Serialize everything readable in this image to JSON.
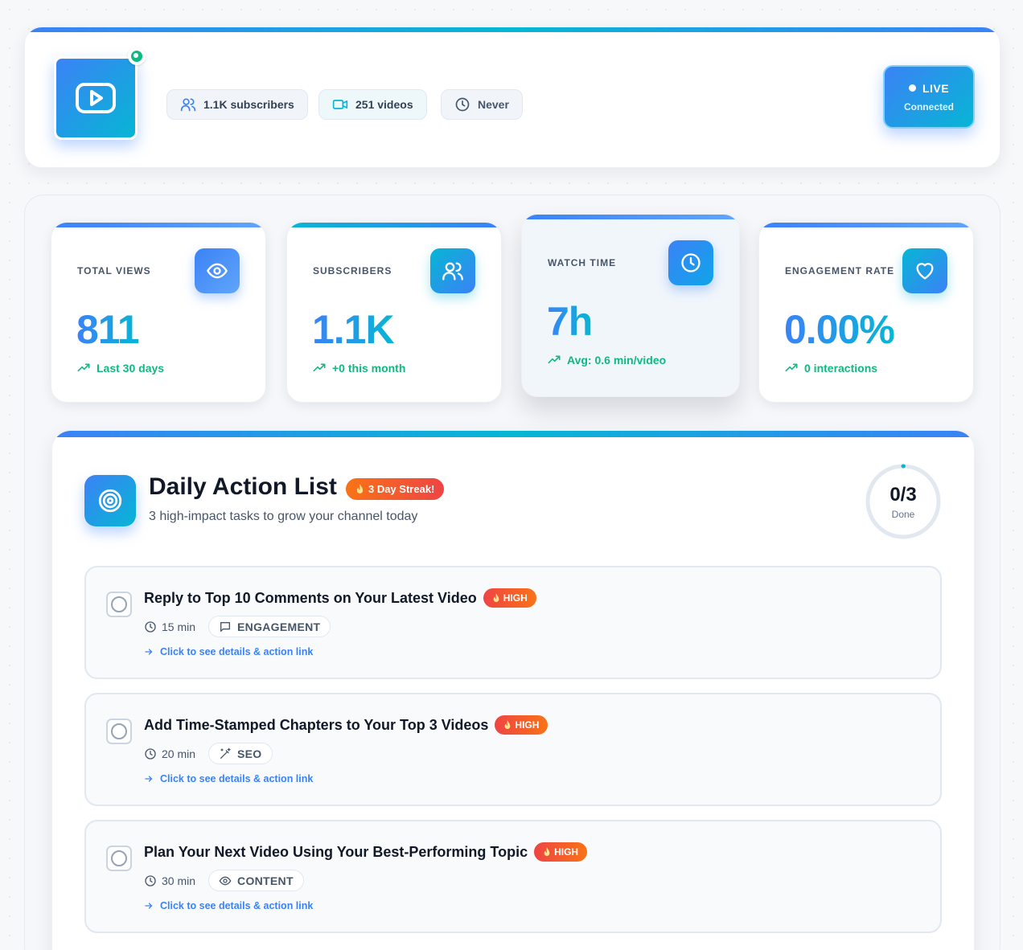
{
  "header": {
    "live_label": "LIVE",
    "live_status": "Connected",
    "chips": {
      "subscribers": "1.1K subscribers",
      "videos": "251 videos",
      "last_sync": "Never"
    }
  },
  "stats": [
    {
      "label": "TOTAL VIEWS",
      "value": "811",
      "sub": "Last 30 days",
      "icon": "eye-icon"
    },
    {
      "label": "SUBSCRIBERS",
      "value": "1.1K",
      "sub": "+0 this month",
      "icon": "users-icon"
    },
    {
      "label": "WATCH TIME",
      "value": "7h",
      "sub": "Avg: 0.6 min/video",
      "icon": "clock-icon"
    },
    {
      "label": "ENGAGEMENT RATE",
      "value": "0.00%",
      "sub": "0 interactions",
      "icon": "heart-icon"
    }
  ],
  "actions": {
    "title": "Daily Action List",
    "streak": "3 Day Streak!",
    "subtitle": "3 high-impact tasks to grow your channel today",
    "progress": {
      "count": "0/3",
      "label": "Done",
      "completed": 0,
      "total": 3
    },
    "tasks": [
      {
        "title": "Reply to Top 10 Comments on Your Latest Video",
        "priority": "HIGH",
        "duration": "15 min",
        "category": "ENGAGEMENT",
        "category_icon": "comment-icon",
        "link": "Click to see details & action link"
      },
      {
        "title": "Add Time-Stamped Chapters to Your Top 3 Videos",
        "priority": "HIGH",
        "duration": "20 min",
        "category": "SEO",
        "category_icon": "magic-wand-icon",
        "link": "Click to see details & action link"
      },
      {
        "title": "Plan Your Next Video Using Your Best-Performing Topic",
        "priority": "HIGH",
        "duration": "30 min",
        "category": "CONTENT",
        "category_icon": "eye-icon",
        "link": "Click to see details & action link"
      }
    ]
  },
  "colors": {
    "accent_blue": "#3b82f6",
    "accent_cyan": "#06b6d4",
    "positive_green": "#10b981",
    "priority_red": "#ef4444",
    "priority_orange": "#f97316"
  }
}
